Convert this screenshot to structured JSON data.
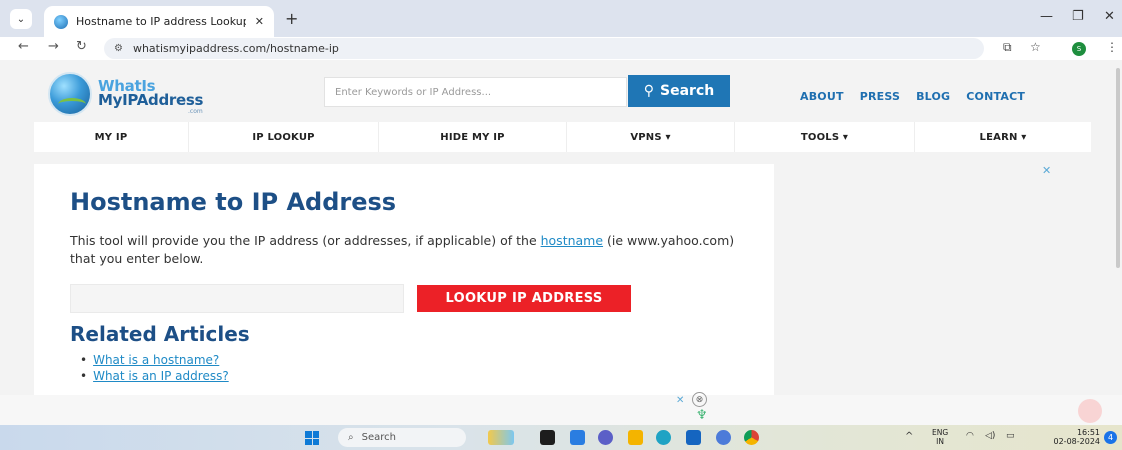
{
  "browser": {
    "tab_title": "Hostname to IP address Lookup",
    "url": "whatismyipaddress.com/hostname-ip",
    "new_tab_symbol": "+",
    "minimize_symbol": "—",
    "restore_symbol": "❐",
    "close_symbol": "✕",
    "profile_initial": "S",
    "icons": [
      "chevron-down-icon",
      "back-icon",
      "forward-icon",
      "reload-icon",
      "site-info-icon",
      "cast-icon",
      "star-icon",
      "menu-icon"
    ]
  },
  "site": {
    "logo_line1": "WhatIs",
    "logo_line2": "MyIPAddress",
    "logo_com": ".com",
    "search_placeholder": "Enter Keywords or IP Address...",
    "search_button": "Search",
    "top_links": [
      "ABOUT",
      "PRESS",
      "BLOG",
      "CONTACT"
    ],
    "nav": [
      "MY IP",
      "IP LOOKUP",
      "HIDE MY IP",
      "VPNS ▾",
      "TOOLS ▾",
      "LEARN ▾"
    ]
  },
  "main": {
    "title": "Hostname to IP Address",
    "intro_before": "This tool will provide you the IP address (or addresses, if applicable) of the ",
    "intro_link": "hostname",
    "intro_after": " (ie www.yahoo.com) that you enter below.",
    "lookup_button": "LOOKUP IP ADDRESS",
    "related_title": "Related Articles",
    "related": [
      "What is a hostname?",
      "What is an IP address?"
    ]
  },
  "ads": {
    "close_symbol": "✕"
  },
  "taskbar": {
    "search_label": "Search",
    "lang_line1": "ENG",
    "lang_line2": "IN",
    "time": "16:51",
    "date": "02-08-2024",
    "notification_count": "4",
    "tray_chevron": "^"
  }
}
